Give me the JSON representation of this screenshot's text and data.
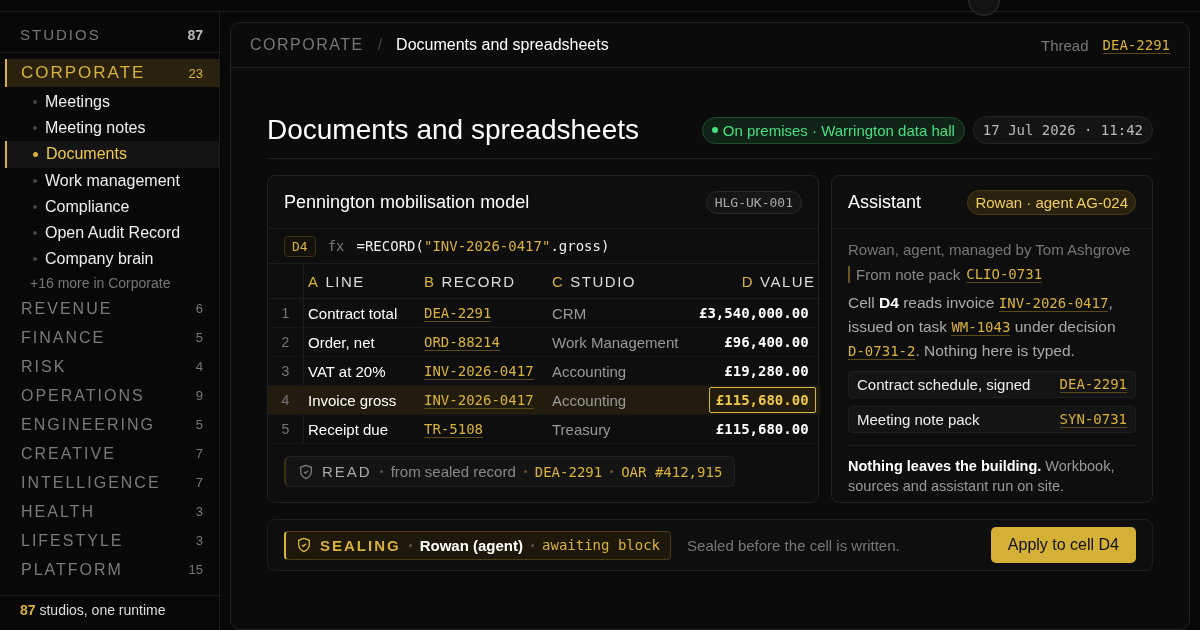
{
  "sidebar": {
    "heading": {
      "label": "STUDIOS",
      "count": "87"
    },
    "groups": [
      {
        "label": "CORPORATE",
        "count": "23",
        "selected": true,
        "children": [
          {
            "label": "Meetings",
            "selected": false
          },
          {
            "label": "Meeting notes",
            "selected": false
          },
          {
            "label": "Documents",
            "selected": true
          },
          {
            "label": "Work management",
            "selected": false
          },
          {
            "label": "Compliance",
            "selected": false
          },
          {
            "label": "Open Audit Record",
            "selected": false
          },
          {
            "label": "Company brain",
            "selected": false
          }
        ],
        "more": {
          "count": "+16",
          "label": "more in Corporate"
        }
      },
      {
        "label": "REVENUE",
        "count": "6",
        "selected": false
      },
      {
        "label": "FINANCE",
        "count": "5",
        "selected": false
      },
      {
        "label": "RISK",
        "count": "4",
        "selected": false
      },
      {
        "label": "OPERATIONS",
        "count": "9",
        "selected": false
      },
      {
        "label": "ENGINEERING",
        "count": "5",
        "selected": false
      },
      {
        "label": "CREATIVE",
        "count": "7",
        "selected": false
      },
      {
        "label": "INTELLIGENCE",
        "count": "7",
        "selected": false
      },
      {
        "label": "HEALTH",
        "count": "3",
        "selected": false
      },
      {
        "label": "LIFESTYLE",
        "count": "3",
        "selected": false
      },
      {
        "label": "PLATFORM",
        "count": "15",
        "selected": false
      }
    ],
    "footer": "**87** studios, one runtime"
  },
  "breadcrumb": {
    "section": "CORPORATE",
    "separator": "/",
    "page": "Documents and spreadsheets"
  },
  "thread": {
    "label": "Thread",
    "id": "DEA-2291"
  },
  "title": "Documents and spreadsheets",
  "status": "On premises · Warrington data hall",
  "timestamp": "17 Jul 2026 · 11:42",
  "sheet": {
    "title": "Pennington mobilisation model",
    "tag": "HLG-UK-001",
    "formula": {
      "cell": "D4",
      "prefix": "fx",
      "before": "=RECORD(",
      "argument": "\"INV-2026-0417\"",
      "after": ".gross)"
    },
    "columns": [
      {
        "letter": "A",
        "label": "LINE"
      },
      {
        "letter": "B",
        "label": "RECORD"
      },
      {
        "letter": "C",
        "label": "STUDIO"
      },
      {
        "letter": "D",
        "label": "VALUE"
      }
    ],
    "rows": [
      {
        "number": "1",
        "line": "Contract total",
        "record": "DEA-2291",
        "studio": "CRM",
        "value": "£3,540,000.00",
        "selected": false
      },
      {
        "number": "2",
        "line": "Order, net",
        "record": "ORD-88214",
        "studio": "Work Management",
        "value": "£96,400.00",
        "selected": false
      },
      {
        "number": "3",
        "line": "VAT at 20%",
        "record": "INV-2026-0417",
        "studio": "Accounting",
        "value": "£19,280.00",
        "selected": false
      },
      {
        "number": "4",
        "line": "Invoice gross",
        "record": "INV-2026-0417",
        "studio": "Accounting",
        "value": "£115,680.00",
        "selected": true
      },
      {
        "number": "5",
        "line": "Receipt due",
        "record": "TR-5108",
        "studio": "Treasury",
        "value": "£115,680.00",
        "selected": false
      }
    ],
    "read": {
      "label": "READ",
      "text": "from sealed record",
      "refs": [
        "DEA-2291",
        "OAR #412,915"
      ]
    }
  },
  "assistant": {
    "title": "Assistant",
    "agent": "Rowan · agent AG-024",
    "meta": "Rowan, agent, managed by Tom Ashgrove",
    "source": {
      "label": "From note pack",
      "ref": "CLIO-0731"
    },
    "message": [
      {
        "kind": "text",
        "text": "Cell "
      },
      {
        "kind": "bold",
        "text": "D4"
      },
      {
        "kind": "text",
        "text": " reads invoice "
      },
      {
        "kind": "ref",
        "text": "INV-2026-0417"
      },
      {
        "kind": "text",
        "text": ", issued on task "
      },
      {
        "kind": "ref",
        "text": "WM-1043"
      },
      {
        "kind": "text",
        "text": " under decision "
      },
      {
        "kind": "ref",
        "text": "D-0731-2"
      },
      {
        "kind": "text",
        "text": ". Nothing here is typed."
      }
    ],
    "records": [
      {
        "label": "Contract schedule, signed",
        "ref": "DEA-2291"
      },
      {
        "label": "Meeting note pack",
        "ref": "SYN-0731"
      }
    ],
    "note": "**Nothing leaves the building.** Workbook, sources and assistant run on site."
  },
  "sealing": {
    "label": "SEALING",
    "actor": "Rowan (agent)",
    "status": "awaiting block",
    "note": "Sealed before the cell is written.",
    "button": "Apply to cell D4"
  }
}
